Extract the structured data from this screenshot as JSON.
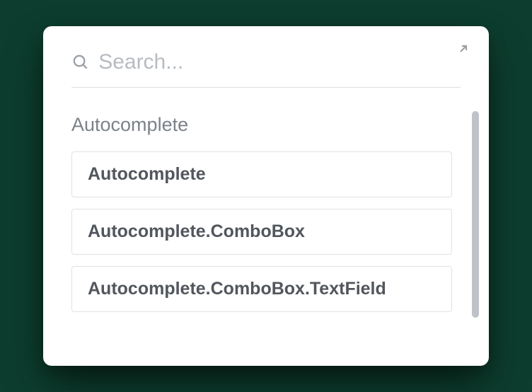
{
  "search": {
    "placeholder": "Search...",
    "value": ""
  },
  "section": {
    "heading": "Autocomplete",
    "results": [
      {
        "label": "Autocomplete"
      },
      {
        "label": "Autocomplete.ComboBox"
      },
      {
        "label": "Autocomplete.ComboBox.TextField"
      }
    ]
  }
}
